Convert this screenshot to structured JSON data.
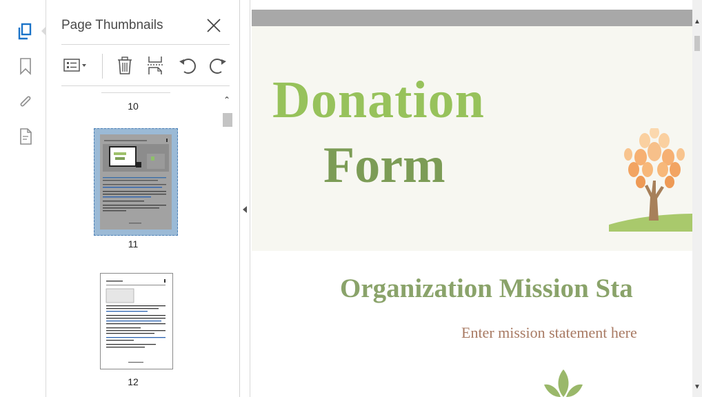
{
  "panel": {
    "title": "Page Thumbnails",
    "thumbnails": [
      {
        "page": "10"
      },
      {
        "page": "11"
      },
      {
        "page": "12"
      }
    ]
  },
  "toolbar": {
    "icons": [
      "page-options-icon",
      "delete-page-icon",
      "insert-page-icon",
      "rotate-counterclockwise-icon",
      "rotate-clockwise-icon"
    ]
  },
  "rail": {
    "icons": [
      "page-thumbnails-icon",
      "bookmark-icon",
      "attachment-icon",
      "document-icon"
    ]
  },
  "document": {
    "title_line1": "Donation",
    "title_line2": "Form",
    "mission_heading": "Organization Mission Sta",
    "mission_text": "Enter mission statement here"
  },
  "colors": {
    "title_green": "#97c25b",
    "title_dark_green": "#7c9c56",
    "heading_green": "#8aa36a",
    "mission_text_brown": "#a87a63",
    "accent_blue": "#1a73c8",
    "banner_bg": "#f7f7f1"
  }
}
